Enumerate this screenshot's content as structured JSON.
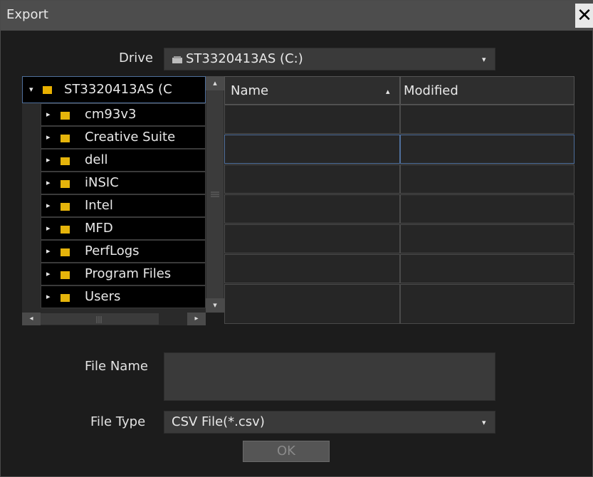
{
  "window": {
    "title": "Export",
    "close_glyph": "✕"
  },
  "drive": {
    "label": "Drive",
    "value": "ST3320413AS (C:)",
    "icon": "drive-icon"
  },
  "tree": {
    "root": "ST3320413AS (C",
    "items": [
      "cm93v3",
      "Creative Suite",
      "dell",
      "iNSIC",
      "Intel",
      "MFD",
      "PerfLogs",
      "Program Files",
      "Users"
    ]
  },
  "list": {
    "columns": [
      "Name",
      "Modified"
    ],
    "sort_column": "Name",
    "rows": [
      [
        "",
        ""
      ],
      [
        "",
        ""
      ],
      [
        "",
        ""
      ],
      [
        "",
        ""
      ],
      [
        "",
        ""
      ],
      [
        "",
        ""
      ],
      [
        "",
        ""
      ]
    ]
  },
  "file_name": {
    "label": "File Name",
    "value": ""
  },
  "file_type": {
    "label": "File Type",
    "value": "CSV File(*.csv)"
  },
  "ok_label": "OK",
  "colors": {
    "folder": "#e5b40b",
    "selection": "#4f6f9c",
    "background": "#1c1c1c"
  }
}
